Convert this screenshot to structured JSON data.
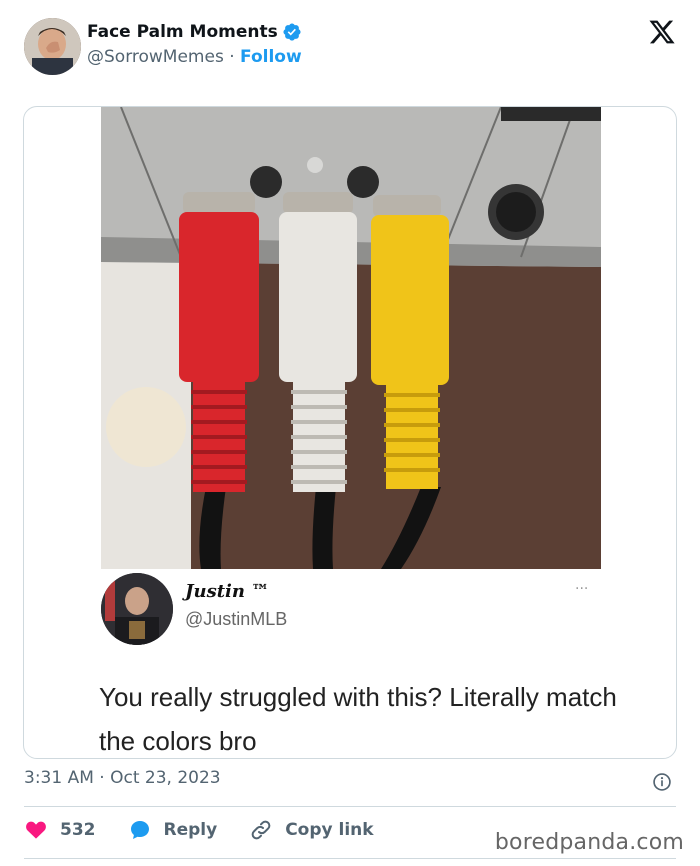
{
  "header": {
    "display_name": "Face Palm Moments",
    "handle": "@SorrowMemes",
    "separator": "·",
    "follow_label": "Follow"
  },
  "embedded_post": {
    "name": "Justin ™",
    "handle": "@JustinMLB",
    "more": "···",
    "text": "You really struggled with this? Literally match the colors bro"
  },
  "footer": {
    "timestamp": "3:31 AM · Oct 23, 2023",
    "like_count": "532",
    "reply_label": "Reply",
    "copy_link_label": "Copy link"
  },
  "watermark": "boredpanda.com",
  "colors": {
    "accent": "#1d9bf0",
    "like": "#f91880",
    "text": "#0f1419",
    "muted": "#536471",
    "cable_red": "#d9262c",
    "cable_white": "#e8e6e1",
    "cable_yellow": "#f0c419"
  },
  "icons": [
    "verified-badge-icon",
    "x-logo-icon",
    "info-icon",
    "heart-icon",
    "reply-icon",
    "link-icon"
  ]
}
